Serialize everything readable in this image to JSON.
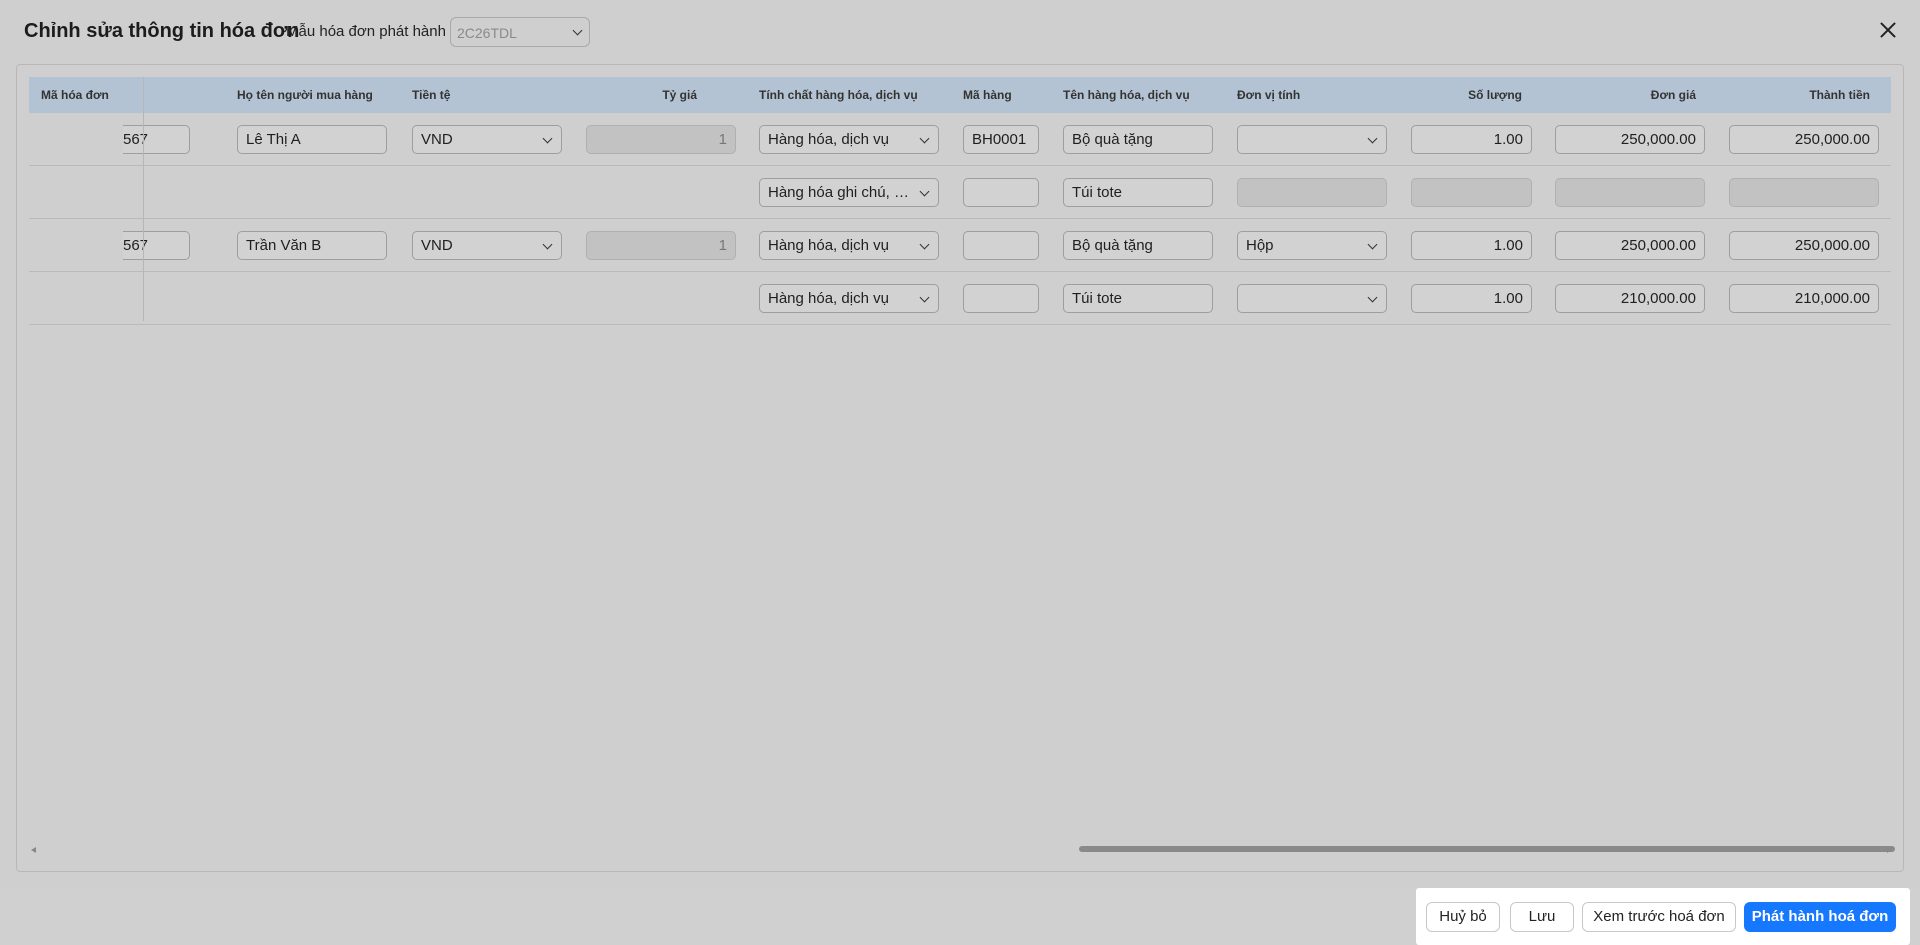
{
  "header": {
    "title": "Chỉnh sửa thông tin hóa đơn",
    "template_label": "Mẫu hóa đơn phát hành",
    "template_value": "2C26TDL"
  },
  "table": {
    "columns": {
      "ma_hoa_don": "Mã hóa đơn",
      "buyer": "Họ tên người mua hàng",
      "currency": "Tiền tệ",
      "rate": "Tỷ giá",
      "nature": "Tính chất hàng hóa, dịch vụ",
      "code": "Mã hàng",
      "name": "Tên hàng hóa, dịch vụ",
      "unit": "Đơn vị tính",
      "qty": "Số lượng",
      "price": "Đơn giá",
      "amount": "Thành tiền"
    },
    "rows": [
      {
        "id_partial": "567",
        "buyer": "Lê Thị A",
        "currency": "VND",
        "rate": "1",
        "nature": "Hàng hóa, dịch vụ",
        "code": "BH0001",
        "name": "Bộ quà tặng",
        "unit": "",
        "qty": "1.00",
        "price": "250,000.00",
        "amount": "250,000.00"
      },
      {
        "nature": "Hàng hóa ghi chú, diễn giải",
        "code": "",
        "name": "Túi tote"
      },
      {
        "id_partial": "567",
        "buyer": "Trần Văn B",
        "currency": "VND",
        "rate": "1",
        "nature": "Hàng hóa, dịch vụ",
        "code": "",
        "name": "Bộ quà tặng",
        "unit": "Hộp",
        "qty": "1.00",
        "price": "250,000.00",
        "amount": "250,000.00"
      },
      {
        "nature": "Hàng hóa, dịch vụ",
        "code": "",
        "name": "Túi tote",
        "unit": "",
        "qty": "1.00",
        "price": "210,000.00",
        "amount": "210,000.00"
      }
    ]
  },
  "footer": {
    "cancel": "Huỷ bỏ",
    "save": "Lưu",
    "preview": "Xem trước hoá đơn",
    "issue": "Phát hành hoá đơn"
  },
  "colors": {
    "primary": "#1677ff",
    "table_header": "#b3c3d3",
    "background": "#cfcfcf"
  }
}
